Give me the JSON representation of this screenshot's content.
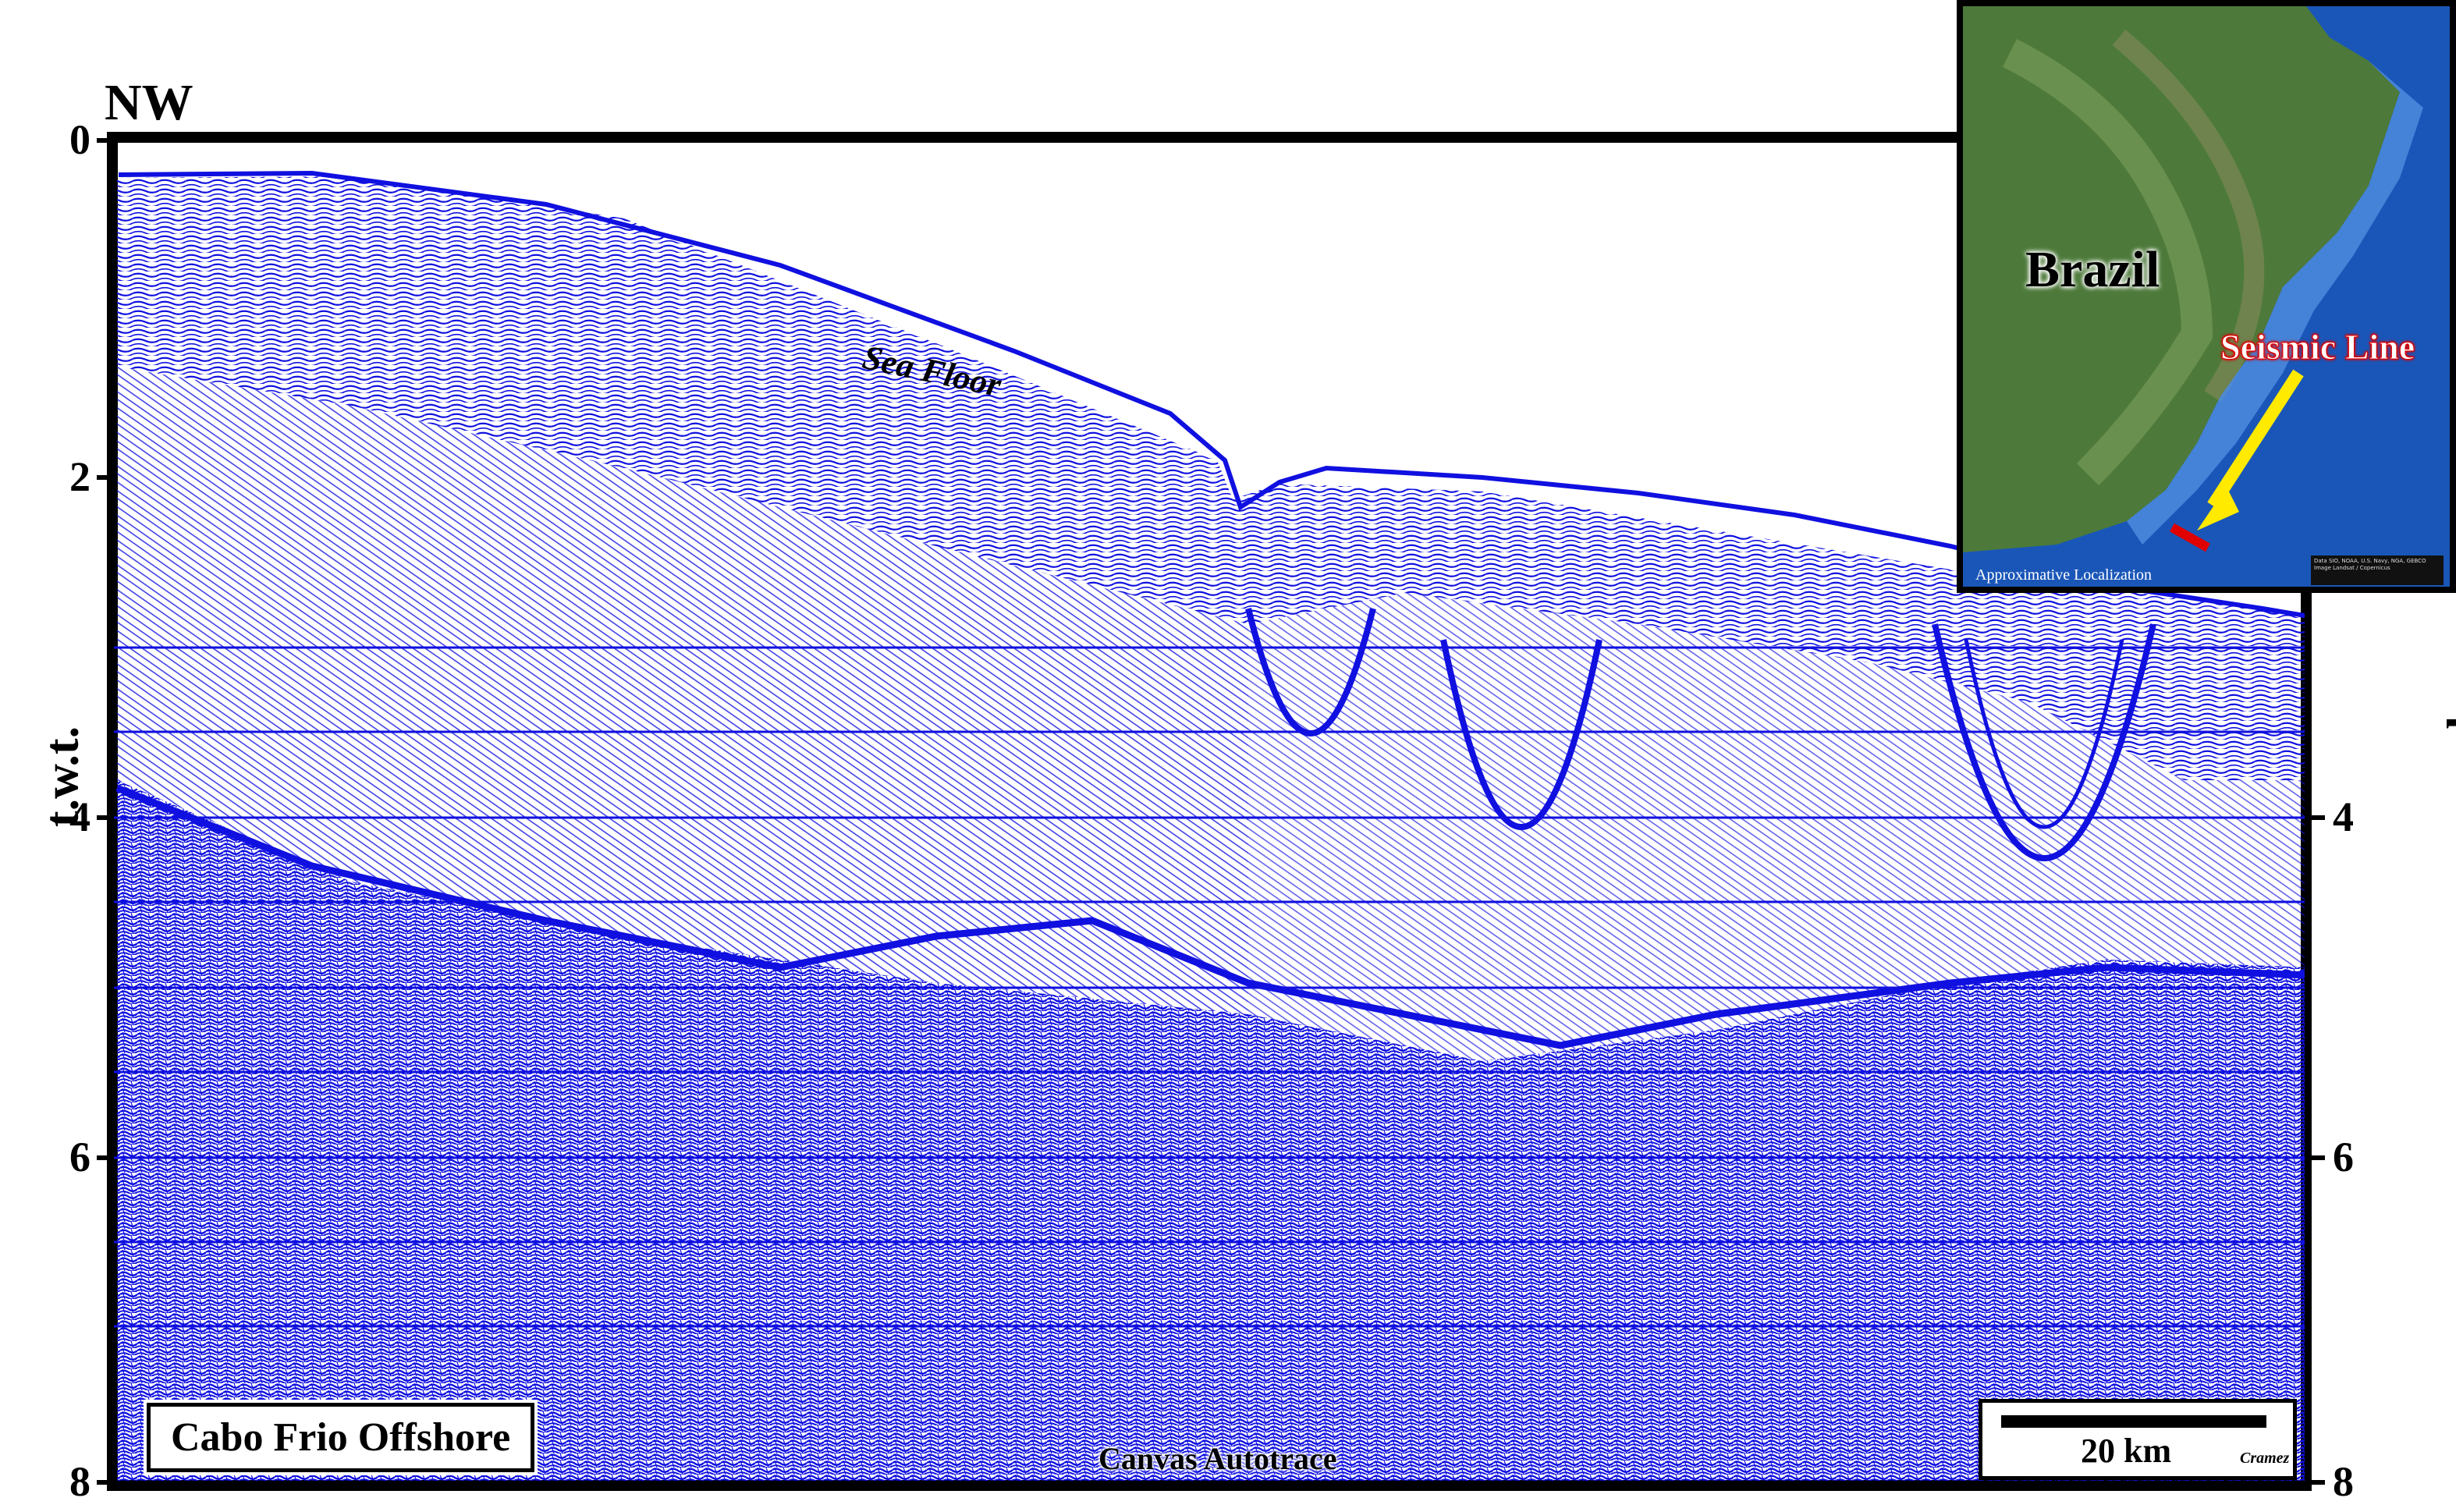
{
  "direction_label": "NW",
  "left_axis_title": "t.w.t.",
  "right_axis_title": "seconds",
  "left_ticks": [
    "0",
    "2",
    "4",
    "6",
    "8"
  ],
  "right_ticks": [
    "4",
    "6",
    "8"
  ],
  "feature_label": "Sea Floor",
  "location_label": "Cabo Frio Offshore",
  "scale_label": "20 km",
  "scale_credit": "Cramez",
  "watermark": "Canvas Autotrace",
  "inset": {
    "country_label": "Brazil",
    "line_label": "Seismic Line",
    "note": "Approximative Localization",
    "credit": "Data SIO, NOAA, U.S. Navy, NGA, GEBCO Image Landsat / Copernicus"
  },
  "colors": {
    "seismic": "#1010e0",
    "frame": "#000000",
    "ocean_inset": "#1a56b8",
    "land_inset": "#4d7a3a",
    "line_marker": "#e00000",
    "arrow": "#ffea00"
  }
}
